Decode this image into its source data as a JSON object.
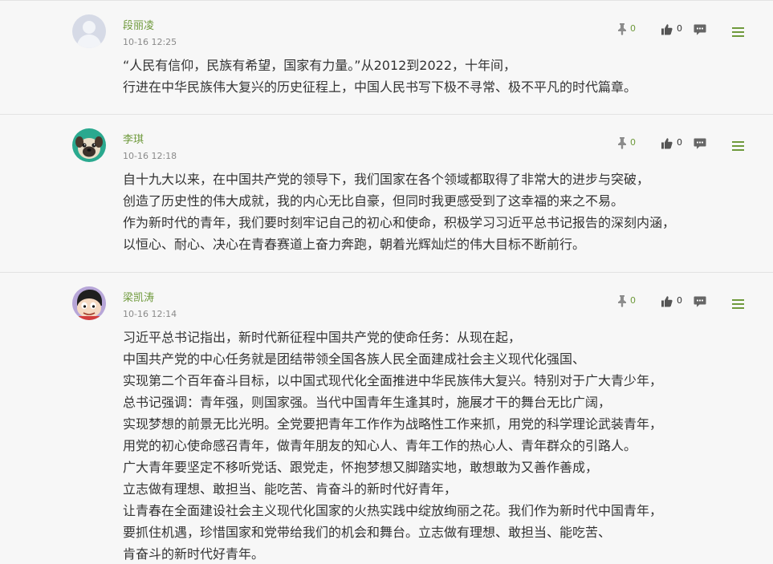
{
  "comments": [
    {
      "author": "段丽凌",
      "time": "10-16 12:25",
      "pin_count": "0",
      "like_count": "0",
      "avatar": "default-avatar",
      "lines": [
        "“人民有信仰，民族有希望，国家有力量。”从2012到2022，十年间，",
        "行进在中华民族伟大复兴的历史征程上，中国人民书写下极不寻常、极不平凡的时代篇章。"
      ]
    },
    {
      "author": "李琪",
      "time": "10-16 12:18",
      "pin_count": "0",
      "like_count": "0",
      "avatar": "pug-avatar",
      "lines": [
        "自十九大以来，在中国共产党的领导下，我们国家在各个领域都取得了非常大的进步与突破，",
        "创造了历史性的伟大成就，我的内心无比自豪，但同时我更感受到了这幸福的来之不易。",
        "作为新时代的青年，我们要时刻牢记自己的初心和使命，积极学习习近平总书记报告的深刻内涵，",
        "以恒心、耐心、决心在青春赛道上奋力奔跑，朝着光辉灿烂的伟大目标不断前行。"
      ]
    },
    {
      "author": "梁凯涛",
      "time": "10-16 12:14",
      "pin_count": "0",
      "like_count": "0",
      "avatar": "cartoon-avatar",
      "lines": [
        "习近平总书记指出，新时代新征程中国共产党的使命任务：从现在起，",
        "中国共产党的中心任务就是团结带领全国各族人民全面建成社会主义现代化强国、",
        "实现第二个百年奋斗目标，以中国式现代化全面推进中华民族伟大复兴。特别对于广大青少年，",
        "总书记强调：青年强，则国家强。当代中国青年生逢其时，施展才干的舞台无比广阔，",
        "实现梦想的前景无比光明。全党要把青年工作作为战略性工作来抓，用党的科学理论武装青年，",
        "用党的初心使命感召青年，做青年朋友的知心人、青年工作的热心人、青年群众的引路人。",
        "广大青年要坚定不移听党话、跟党走，怀抱梦想又脚踏实地，敢想敢为又善作善成，",
        "立志做有理想、敢担当、能吃苦、肯奋斗的新时代好青年，",
        "让青春在全面建设社会主义现代化国家的火热实践中绽放绚丽之花。我们作为新时代中国青年，",
        "要抓住机遇，珍惜国家和党带给我们的机会和舞台。立志做有理想、敢担当、能吃苦、",
        "肯奋斗的新时代好青年。"
      ]
    }
  ],
  "icons": {
    "pin": "pin-icon",
    "like": "thumbs-up-icon",
    "reply": "comment-bubble-icon",
    "menu": "hamburger-menu-icon"
  },
  "colors": {
    "accent": "#6f9a3c",
    "text": "#333333",
    "muted": "#8a8a8a",
    "icon_gray": "#8c8c8c",
    "background": "#f7f7f7"
  }
}
